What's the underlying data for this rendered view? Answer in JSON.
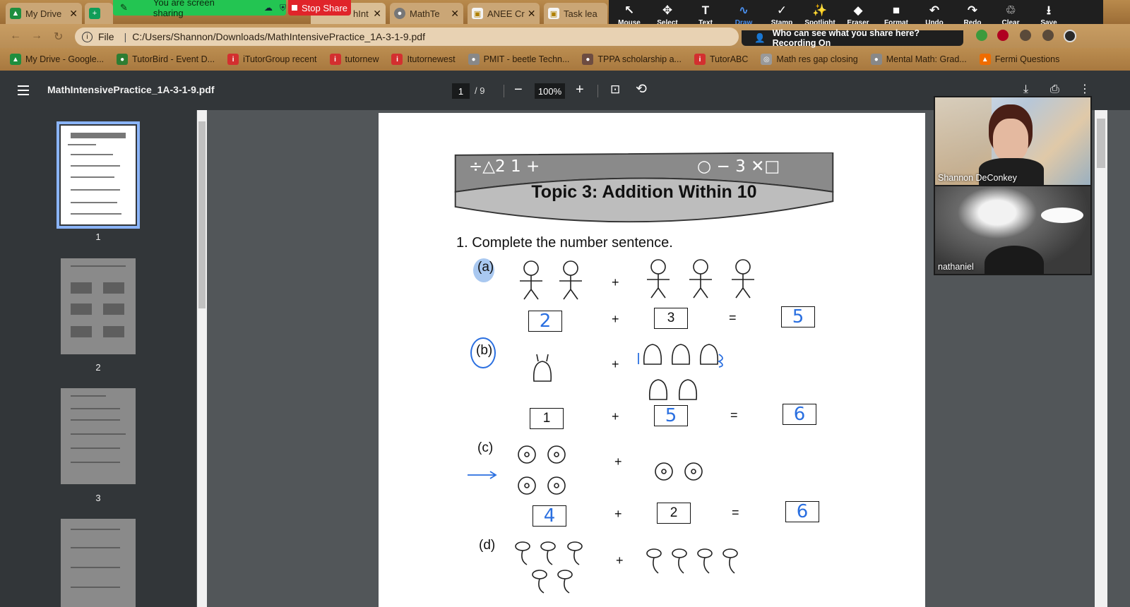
{
  "browser": {
    "tabs": [
      {
        "label": "My Drive",
        "color": "#1e8e3e"
      },
      {
        "label": "",
        "color": "#0f9d58"
      },
      {
        "label": "hInt",
        "color": "#666"
      },
      {
        "label": "MathTe",
        "color": "#666"
      },
      {
        "label": "ANEE Cr",
        "color": "#c4a000"
      },
      {
        "label": "Task lea",
        "color": "#c4a000"
      }
    ],
    "share_banner": "You are screen sharing",
    "stop_share": "Stop Share",
    "scheme": "File",
    "url": "C:/Users/Shannon/Downloads/MathIntensivePractice_1A-3-1-9.pdf",
    "who_can_see": "Who can see what you share here? Recording On"
  },
  "annotation_toolbar": [
    {
      "label": "Mouse",
      "icon": "↖"
    },
    {
      "label": "Select",
      "icon": "✥"
    },
    {
      "label": "Text",
      "icon": "T"
    },
    {
      "label": "Draw",
      "icon": "∿"
    },
    {
      "label": "Stamp",
      "icon": "✓"
    },
    {
      "label": "Spotlight",
      "icon": "✨"
    },
    {
      "label": "Eraser",
      "icon": "◆"
    },
    {
      "label": "Format",
      "icon": "■"
    },
    {
      "label": "Undo",
      "icon": "↶"
    },
    {
      "label": "Redo",
      "icon": "↷"
    },
    {
      "label": "Clear",
      "icon": "♲"
    },
    {
      "label": "Save",
      "icon": "⭳"
    }
  ],
  "bookmarks": [
    {
      "label": "My Drive - Google...",
      "color": "#1e8e3e",
      "glyph": "▲"
    },
    {
      "label": "TutorBird - Event D...",
      "color": "#2e7d32",
      "glyph": "●"
    },
    {
      "label": "iTutorGroup recent",
      "color": "#d32f2f",
      "glyph": "i"
    },
    {
      "label": "tutornew",
      "color": "#d32f2f",
      "glyph": "i"
    },
    {
      "label": "Itutornewest",
      "color": "#d32f2f",
      "glyph": "i"
    },
    {
      "label": "PMIT - beetle Techn...",
      "color": "#888",
      "glyph": "●"
    },
    {
      "label": "TPPA scholarship a...",
      "color": "#6d4c41",
      "glyph": "●"
    },
    {
      "label": "TutorABC",
      "color": "#d32f2f",
      "glyph": "i"
    },
    {
      "label": "Math res gap closing",
      "color": "#999",
      "glyph": "◎"
    },
    {
      "label": "Mental Math: Grad...",
      "color": "#888",
      "glyph": "●"
    },
    {
      "label": "Fermi Questions",
      "color": "#ef6c00",
      "glyph": "▲"
    }
  ],
  "pdf": {
    "filename": "MathIntensivePractice_1A-3-1-9.pdf",
    "current_page": "1",
    "total_pages": "9",
    "zoom": "100%",
    "thumbnails": [
      "1",
      "2",
      "3"
    ]
  },
  "page_content": {
    "topic_title": "Topic 3: Addition Within 10",
    "question": "1.  Complete the number sentence.",
    "parts": [
      {
        "label": "(a)",
        "left_box": "2",
        "right_box": "3",
        "result_box": "5"
      },
      {
        "label": "(b)",
        "left_box": "1",
        "right_box": "5",
        "result_box": "6"
      },
      {
        "label": "(c)",
        "left_box": "4",
        "right_box": "2",
        "result_box": "6"
      },
      {
        "label": "(d)"
      }
    ],
    "plus": "+",
    "equals": "="
  },
  "video": {
    "participants": [
      {
        "name": "Shannon DeConkey"
      },
      {
        "name": "nathaniel"
      }
    ]
  }
}
